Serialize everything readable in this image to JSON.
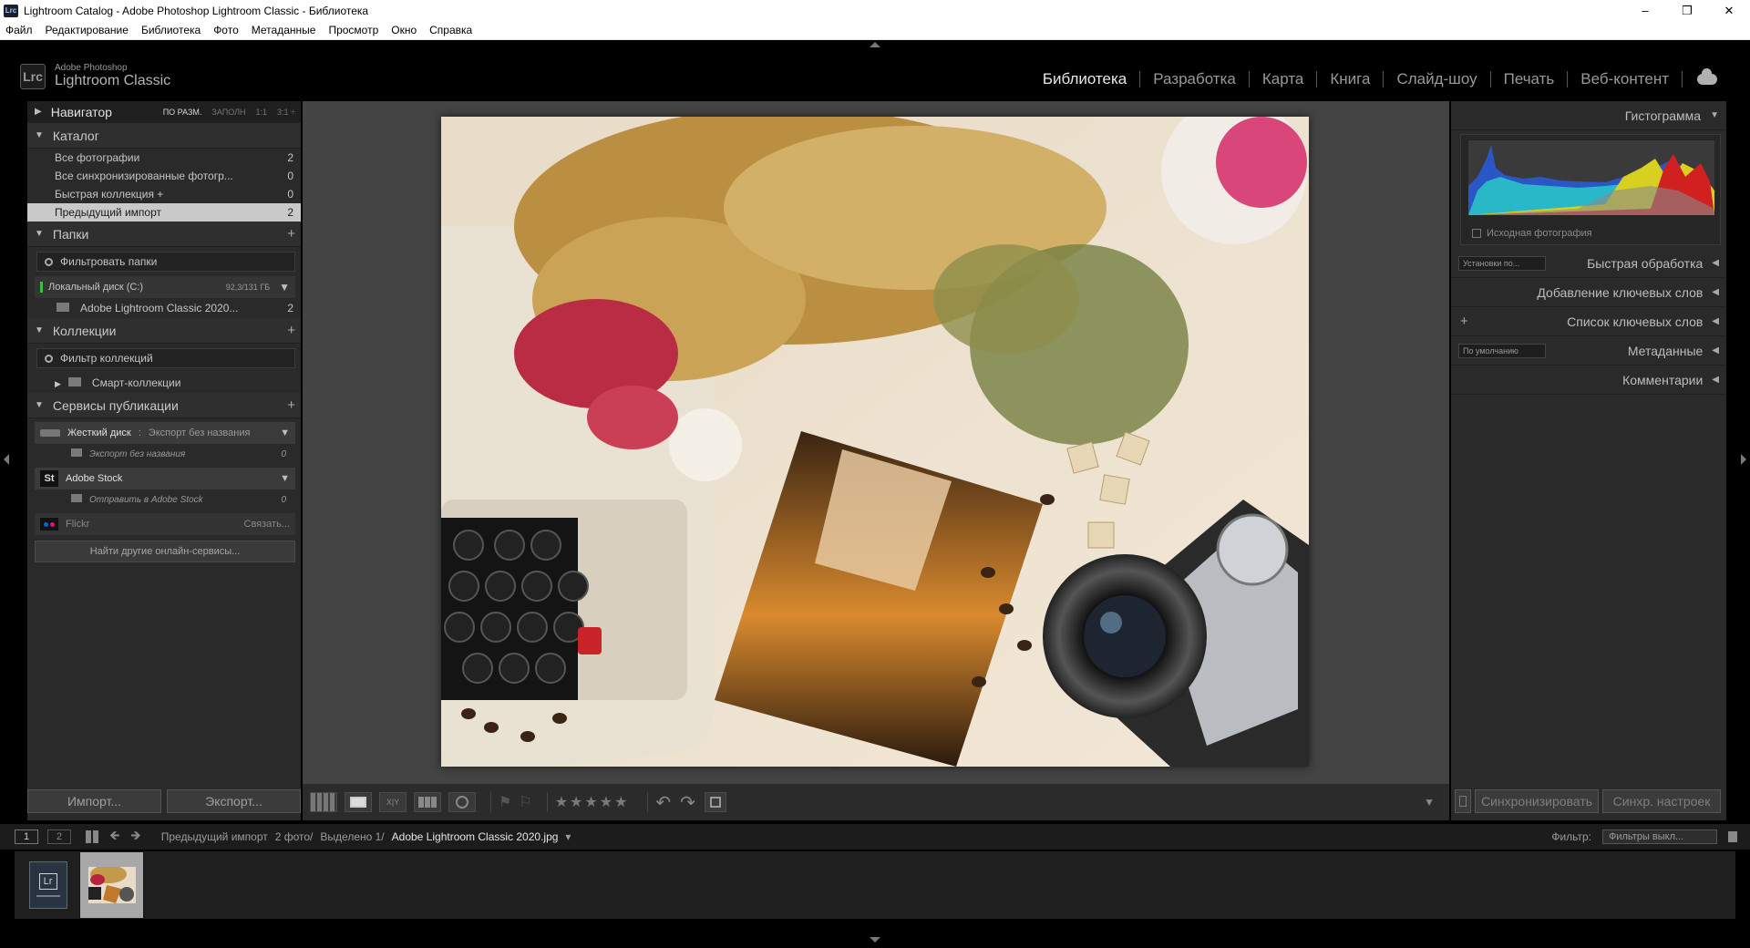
{
  "window": {
    "title": "Lightroom Catalog - Adobe Photoshop Lightroom Classic - Библиотека",
    "icon_text": "Lrc"
  },
  "menu": [
    "Файл",
    "Редактирование",
    "Библиотека",
    "Фото",
    "Метаданные",
    "Просмотр",
    "Окно",
    "Справка"
  ],
  "identity": {
    "badge": "Lrc",
    "line1": "Adobe Photoshop",
    "line2": "Lightroom Classic"
  },
  "modules": [
    "Библиотека",
    "Разработка",
    "Карта",
    "Книга",
    "Слайд-шоу",
    "Печать",
    "Веб-контент"
  ],
  "active_module": "Библиотека",
  "left": {
    "navigator": {
      "title": "Навигатор",
      "opts": [
        "ПО РАЗМ.",
        "ЗАПОЛН",
        "1:1",
        "3:1 ÷"
      ]
    },
    "catalog": {
      "title": "Каталог",
      "items": [
        {
          "label": "Все фотографии",
          "count": "2"
        },
        {
          "label": "Все синхронизированные фотогр...",
          "count": "0"
        },
        {
          "label": "Быстрая коллекция +",
          "count": "0"
        },
        {
          "label": "Предыдущий импорт",
          "count": "2"
        }
      ]
    },
    "folders": {
      "title": "Папки",
      "filter": "Фильтровать папки",
      "disk": {
        "name": "Локальный диск (C:)",
        "cap": "92,3/131 ГБ"
      },
      "folder": {
        "name": "Adobe Lightroom Classic 2020...",
        "count": "2"
      }
    },
    "collections": {
      "title": "Коллекции",
      "filter": "Фильтр коллекций",
      "smart": "Смарт-коллекции"
    },
    "publish": {
      "title": "Сервисы публикации",
      "hd": {
        "name": "Жесткий диск",
        "sep": ":",
        "sub": "Экспорт без названия",
        "child": "Экспорт без названия",
        "count": "0"
      },
      "stock": {
        "icon": "St",
        "name": "Adobe Stock",
        "child": "Отправить в Adobe Stock",
        "count": "0"
      },
      "flickr": {
        "name": "Flickr",
        "action": "Связать..."
      },
      "find": "Найти другие онлайн-сервисы..."
    },
    "import_btn": "Импорт...",
    "export_btn": "Экспорт..."
  },
  "right": {
    "histogram": "Гистограмма",
    "original": "Исходная фотография",
    "quick": {
      "preset": "Установки по...",
      "title": "Быстрая обработка"
    },
    "keywording": "Добавление ключевых слов",
    "keyword_list": "Список ключевых слов",
    "metadata": {
      "preset": "По умолчанию",
      "title": "Метаданные"
    },
    "comments": "Комментарии",
    "sync_btn": "Синхронизировать",
    "sync_settings_btn": "Синхр. настроек"
  },
  "toolbar": {
    "stars": "★★★★★",
    "xy": "X|Y"
  },
  "filmstrip": {
    "page1": "1",
    "page2": "2",
    "source": "Предыдущий импорт",
    "count": "2 фото/",
    "selected": "Выделено 1/",
    "file": "Adobe Lightroom Classic 2020.jpg",
    "filter_label": "Фильтр:",
    "filter_value": "Фильтры выкл...",
    "thumb_lr": "Lr"
  },
  "colors": {
    "accent_selected": "#c9c9c9",
    "panel": "#2a2a2a",
    "workspace": "#444444"
  }
}
